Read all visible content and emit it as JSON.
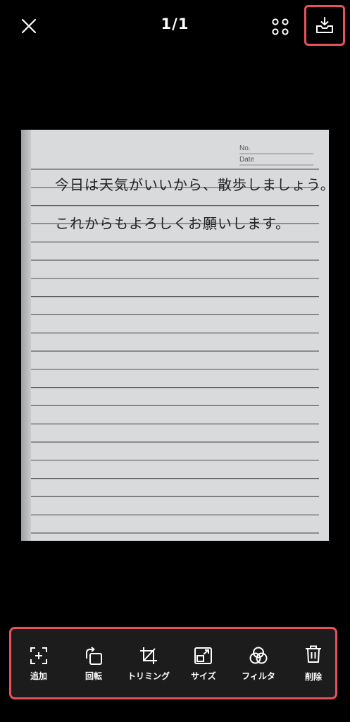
{
  "header": {
    "page_counter": "1/1",
    "close_icon": "close-icon",
    "grid_icon": "grid-icon",
    "save_icon": "download-tray-icon"
  },
  "document": {
    "no_label": "No.",
    "date_label": "Date",
    "line1": "今日は天気がいいから、散歩しましょう。",
    "line2": "これからもよろしくお願いします。"
  },
  "toolbar": {
    "items": [
      {
        "label": "追加",
        "icon": "add-frame-icon"
      },
      {
        "label": "回転",
        "icon": "rotate-icon"
      },
      {
        "label": "トリミング",
        "icon": "crop-icon"
      },
      {
        "label": "サイズ",
        "icon": "resize-icon"
      },
      {
        "label": "フィルタ",
        "icon": "filter-icon"
      },
      {
        "label": "削除",
        "icon": "trash-icon"
      }
    ]
  },
  "colors": {
    "background": "#000000",
    "highlight": "#e8525a",
    "toolbar_bg": "#1c1c1c",
    "paper": "#d9dadb"
  }
}
